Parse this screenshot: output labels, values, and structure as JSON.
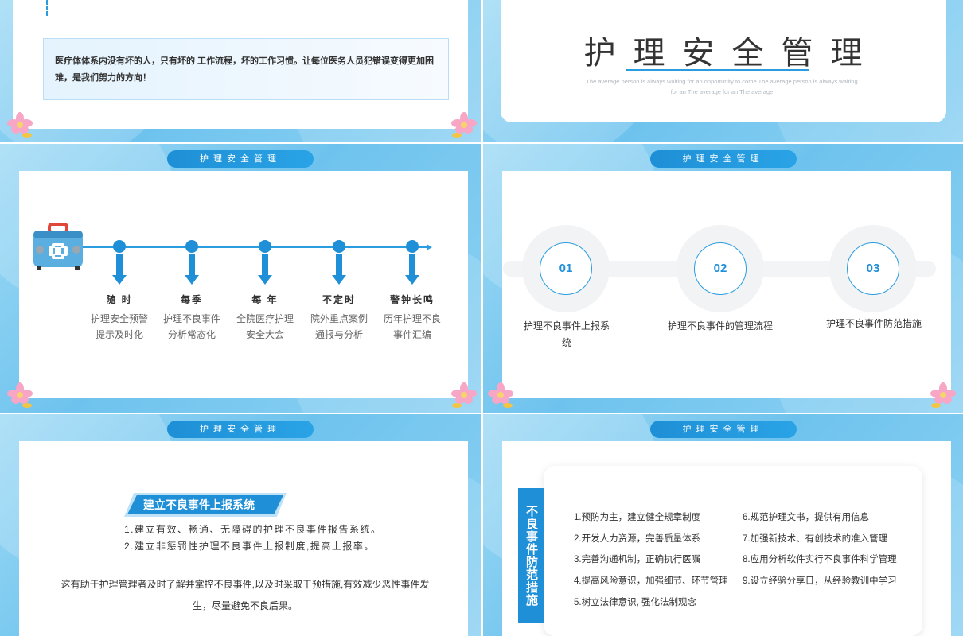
{
  "slide1": {
    "quote": "医疗体体系内没有坏的人，只有坏的 工作流程，坏的工作习惯。让每位医务人员犯错误变得更加困难，是我们努力的方向！"
  },
  "slide2": {
    "title": "护理安全管理",
    "subtitle_line1": "The average person is always waiting for an opportunity to come The average person is always waiting",
    "subtitle_line2": "for an The average for an The average"
  },
  "section_label": "护理安全管理",
  "slide3": {
    "timeline": [
      {
        "head": "随 时",
        "line1": "护理安全预警",
        "line2": "提示及时化"
      },
      {
        "head": "每季",
        "line1": "护理不良事件",
        "line2": "分析常态化"
      },
      {
        "head": "每 年",
        "line1": "全院医疗护理",
        "line2": "安全大会"
      },
      {
        "head": "不定时",
        "line1": "院外重点案例",
        "line2": "通报与分析"
      },
      {
        "head": "警钟长鸣",
        "line1": "历年护理不良",
        "line2": "事件汇编"
      }
    ]
  },
  "slide4": {
    "steps": [
      {
        "num": "01",
        "label_line1": "护理不良事件上报系",
        "label_line2": "统"
      },
      {
        "num": "02",
        "label_line1": "护理不良事件的管理流程",
        "label_line2": ""
      },
      {
        "num": "03",
        "label_line1": "护理不良事件防范措施",
        "label_line2": ""
      }
    ]
  },
  "slide5": {
    "heading": "建立不良事件上报系统",
    "items": [
      "1.建立有效、畅通、无障碍的护理不良事件报告系统。",
      "2.建立非惩罚性护理不良事件上报制度,提高上报率。"
    ],
    "paragraph": "这有助于护理管理者及时了解并掌控不良事件,以及时采取干预措施,有效减少恶性事件发生，尽量避免不良后果。"
  },
  "slide6": {
    "tab": "不良事件防范措施",
    "left": [
      "1.预防为主，建立健全规章制度",
      "2.开发人力资源，完善质量体系",
      "3.完善沟通机制，正确执行医嘱",
      "4.提高风险意识，加强细节、环节管理",
      "5.树立法律意识, 强化法制观念"
    ],
    "right": [
      "6.规范护理文书，提供有用信息",
      "7.加强新技术、有创技术的准入管理",
      "8.应用分析软件实行不良事件科学管理",
      "9.设立经验分享日，从经验教训中学习"
    ]
  },
  "colors": {
    "accent": "#1f8fd8",
    "background": "#8fd2f3"
  }
}
